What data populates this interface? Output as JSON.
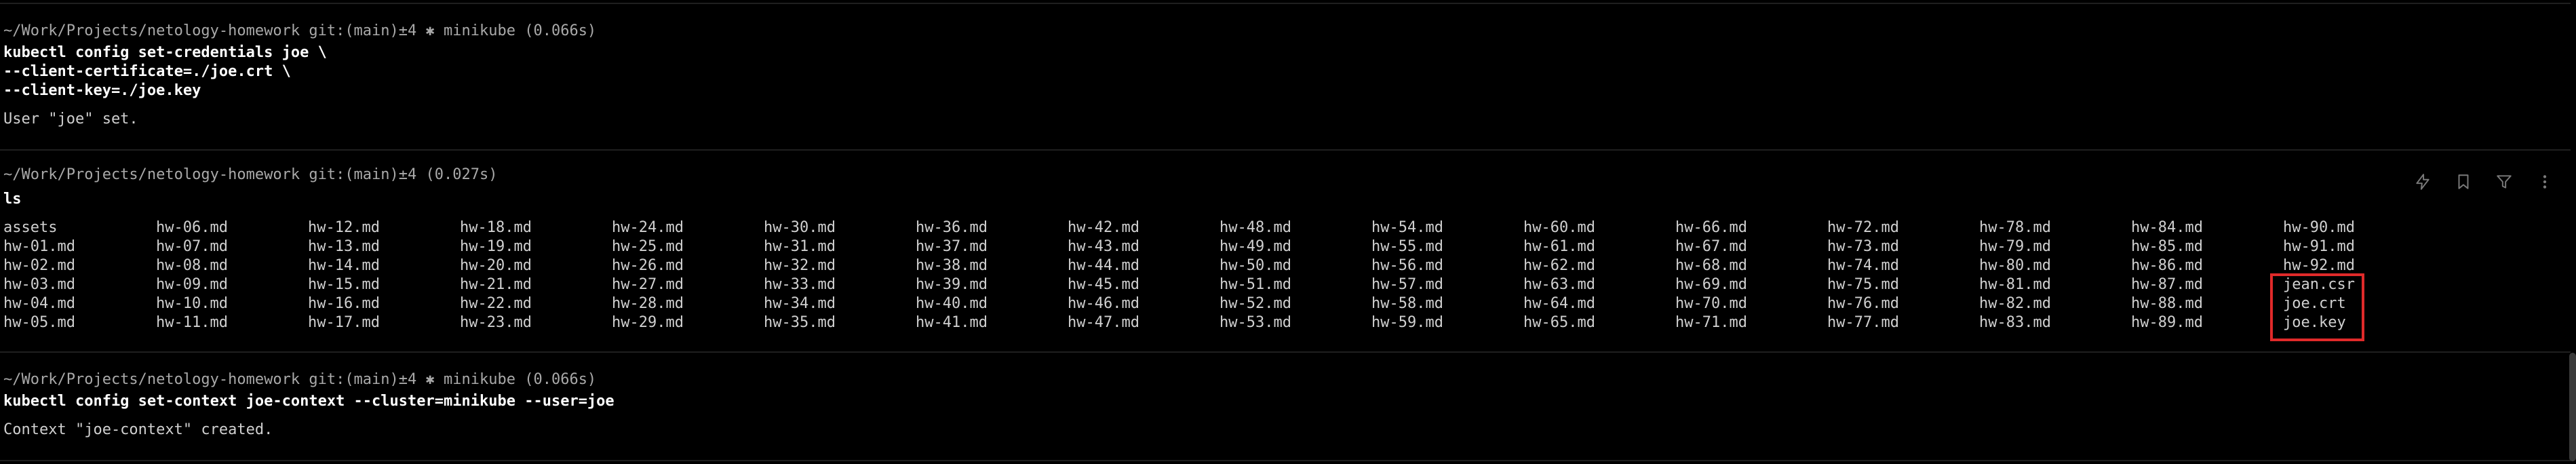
{
  "blocks": [
    {
      "prompt": "~/Work/Projects/netology-homework git:(main)±4 ✱ minikube (0.066s)",
      "command_lines": [
        "kubectl config set-credentials joe \\",
        "--client-certificate=./joe.crt \\",
        "--client-key=./joe.key"
      ],
      "output": "User \"joe\" set."
    },
    {
      "prompt": "~/Work/Projects/netology-homework git:(main)±4 (0.027s)",
      "command": "ls",
      "ls_columns": [
        [
          "assets",
          "hw-01.md",
          "hw-02.md",
          "hw-03.md",
          "hw-04.md",
          "hw-05.md"
        ],
        [
          "hw-06.md",
          "hw-07.md",
          "hw-08.md",
          "hw-09.md",
          "hw-10.md",
          "hw-11.md"
        ],
        [
          "hw-12.md",
          "hw-13.md",
          "hw-14.md",
          "hw-15.md",
          "hw-16.md",
          "hw-17.md"
        ],
        [
          "hw-18.md",
          "hw-19.md",
          "hw-20.md",
          "hw-21.md",
          "hw-22.md",
          "hw-23.md"
        ],
        [
          "hw-24.md",
          "hw-25.md",
          "hw-26.md",
          "hw-27.md",
          "hw-28.md",
          "hw-29.md"
        ],
        [
          "hw-30.md",
          "hw-31.md",
          "hw-32.md",
          "hw-33.md",
          "hw-34.md",
          "hw-35.md"
        ],
        [
          "hw-36.md",
          "hw-37.md",
          "hw-38.md",
          "hw-39.md",
          "hw-40.md",
          "hw-41.md"
        ],
        [
          "hw-42.md",
          "hw-43.md",
          "hw-44.md",
          "hw-45.md",
          "hw-46.md",
          "hw-47.md"
        ],
        [
          "hw-48.md",
          "hw-49.md",
          "hw-50.md",
          "hw-51.md",
          "hw-52.md",
          "hw-53.md"
        ],
        [
          "hw-54.md",
          "hw-55.md",
          "hw-56.md",
          "hw-57.md",
          "hw-58.md",
          "hw-59.md"
        ],
        [
          "hw-60.md",
          "hw-61.md",
          "hw-62.md",
          "hw-63.md",
          "hw-64.md",
          "hw-65.md"
        ],
        [
          "hw-66.md",
          "hw-67.md",
          "hw-68.md",
          "hw-69.md",
          "hw-70.md",
          "hw-71.md"
        ],
        [
          "hw-72.md",
          "hw-73.md",
          "hw-74.md",
          "hw-75.md",
          "hw-76.md",
          "hw-77.md"
        ],
        [
          "hw-78.md",
          "hw-79.md",
          "hw-80.md",
          "hw-81.md",
          "hw-82.md",
          "hw-83.md"
        ],
        [
          "hw-84.md",
          "hw-85.md",
          "hw-86.md",
          "hw-87.md",
          "hw-88.md",
          "hw-89.md"
        ],
        [
          "hw-90.md",
          "hw-91.md",
          "hw-92.md",
          "jean.csr",
          "joe.crt",
          "joe.key"
        ]
      ],
      "toolbar_icons": [
        "lightning-icon",
        "bookmark-icon",
        "filter-icon",
        "more-vertical-icon"
      ]
    },
    {
      "prompt": "~/Work/Projects/netology-homework git:(main)±4 ✱ minikube (0.066s)",
      "command": "kubectl config set-context joe-context --cluster=minikube --user=joe",
      "output": "Context \"joe-context\" created."
    }
  ],
  "colors": {
    "background": "#000000",
    "highlight": "#e02a2a",
    "divider": "#1f1f1f"
  }
}
